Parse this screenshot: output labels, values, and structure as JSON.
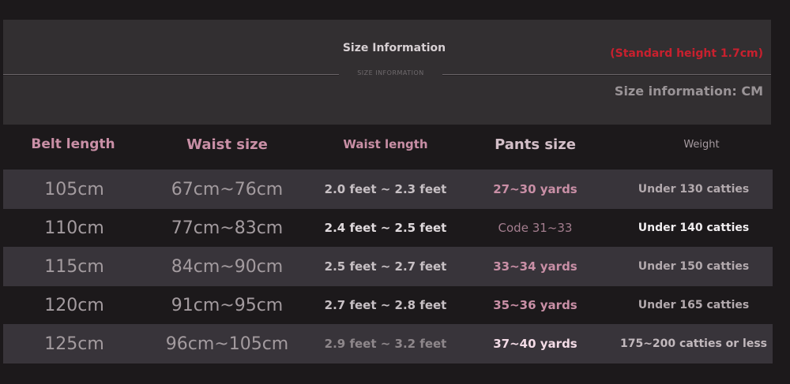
{
  "header": {
    "title": "Size Information",
    "subtitle": "SIZE INFORMATION",
    "standard_note": "(Standard height 1.7cm)",
    "unit_note": "Size information: CM"
  },
  "columns": {
    "belt_length": "Belt length",
    "waist_size": "Waist size",
    "waist_length": "Waist length",
    "pants_size": "Pants size",
    "weight": "Weight"
  },
  "rows": [
    {
      "belt": "105cm",
      "waist": "67cm~76cm",
      "waist_length": "2.0 feet ~ 2.3 feet",
      "pants": "27~30 yards",
      "weight": "Under 130 catties"
    },
    {
      "belt": "110cm",
      "waist": "77cm~83cm",
      "waist_length": "2.4 feet ~ 2.5 feet",
      "pants": "Code 31~33",
      "weight": "Under 140 catties"
    },
    {
      "belt": "115cm",
      "waist": "84cm~90cm",
      "waist_length": "2.5 feet ~ 2.7 feet",
      "pants": "33~34 yards",
      "weight": "Under 150 catties"
    },
    {
      "belt": "120cm",
      "waist": "91cm~95cm",
      "waist_length": "2.7 feet ~ 2.8 feet",
      "pants": "35~36 yards",
      "weight": "Under 165 catties"
    },
    {
      "belt": "125cm",
      "waist": "96cm~105cm",
      "waist_length": "2.9 feet ~ 3.2 feet",
      "pants": "37~40 yards",
      "weight": "175~200 catties or less"
    }
  ],
  "colors": {
    "background": "#1c191b",
    "header_panel": "#322f31",
    "row_band": "#38343a",
    "accent_pink": "#c98fa6",
    "warning_red": "#c8202e"
  }
}
